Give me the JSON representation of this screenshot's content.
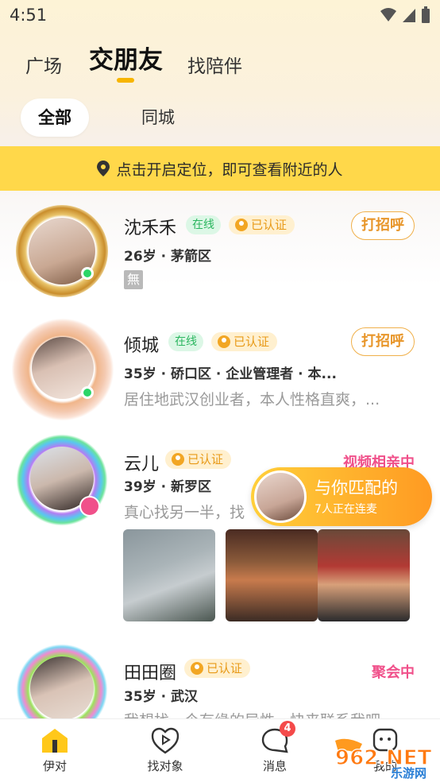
{
  "status_bar": {
    "time": "4:51"
  },
  "top_tabs": [
    {
      "label": "广场",
      "active": false
    },
    {
      "label": "交朋友",
      "active": true
    },
    {
      "label": "找陪伴",
      "active": false
    }
  ],
  "filters": [
    {
      "label": "全部",
      "active": true
    },
    {
      "label": "同城",
      "active": false
    }
  ],
  "location_banner": {
    "text": "点击开启定位，即可查看附近的人"
  },
  "users": [
    {
      "name": "沈禾禾",
      "online_label": "在线",
      "verified_label": "已认证",
      "meta": "26岁 · 茅箭区",
      "tag": "無",
      "action": "打招呼"
    },
    {
      "name": "倾城",
      "online_label": "在线",
      "verified_label": "已认证",
      "meta": "35岁 · 硚口区 · 企业管理者 · 本...",
      "bio": "居住地武汉创业者，本人性格直爽，...",
      "action": "打招呼"
    },
    {
      "name": "云儿",
      "verified_label": "已认证",
      "meta": "39岁 · 新罗区",
      "bio": "真心找另一半，找",
      "status": "视频相亲中"
    },
    {
      "name": "田田圈",
      "verified_label": "已认证",
      "meta": "35岁 · 武汉",
      "bio": "我想找一个有缘的异性，快来联系我吧",
      "status": "聚会中"
    }
  ],
  "match_popup": {
    "title": "与你匹配的",
    "subtitle": "7人正在连麦"
  },
  "bottom_nav": [
    {
      "label": "伊对",
      "icon": "home-icon",
      "active": true
    },
    {
      "label": "找对象",
      "icon": "play-heart-icon",
      "active": false
    },
    {
      "label": "消息",
      "icon": "chat-bubble-icon",
      "badge": "4",
      "active": false
    },
    {
      "label": "我的",
      "icon": "profile-icon",
      "active": false
    }
  ],
  "watermark": {
    "text": "962.NET",
    "sub": "乐游网"
  },
  "colors": {
    "accent": "#ffd84a",
    "online": "#2bd567",
    "live": "#f0508a",
    "greet": "#e8962a"
  }
}
